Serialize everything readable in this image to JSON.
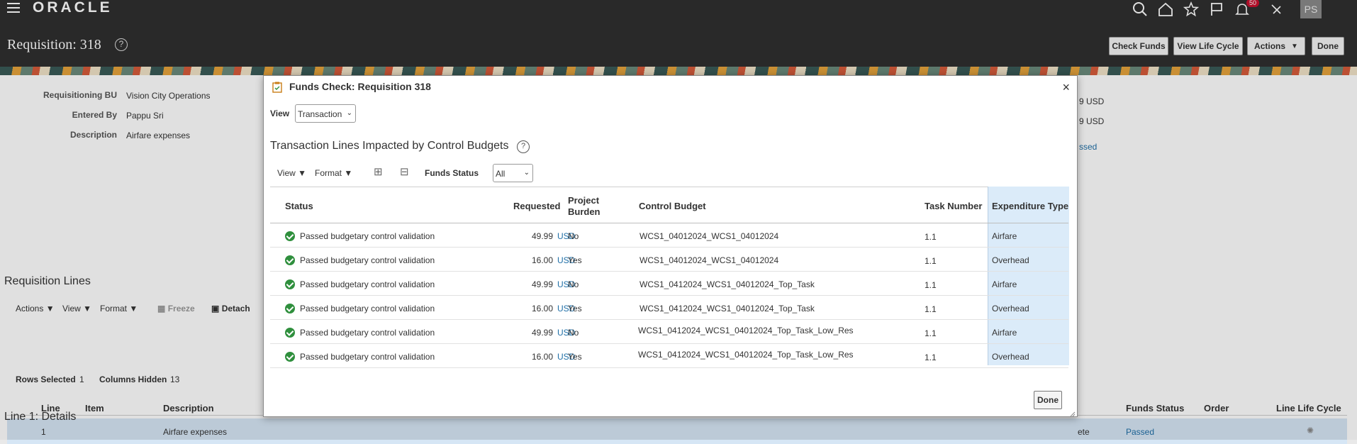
{
  "app": {
    "logo": "ORACLE",
    "notifications_count": "50",
    "user_initials": "PS"
  },
  "page": {
    "title": "Requisition: 318",
    "help": "?",
    "buttons": {
      "check_funds": "Check Funds",
      "view_life_cycle": "View Life Cycle",
      "actions": "Actions",
      "done": "Done"
    }
  },
  "summary": {
    "requisitioning_bu_label": "Requisitioning BU",
    "requisitioning_bu": "Vision City Operations",
    "entered_by_label": "Entered By",
    "entered_by": "Pappu Sri",
    "description_label": "Description",
    "description": "Airfare expenses",
    "right_val_1": "9 USD",
    "right_val_2": "9 USD",
    "right_val_3": "ssed"
  },
  "requisition_lines": {
    "title": "Requisition Lines",
    "toolbar": {
      "actions": "Actions",
      "view": "View",
      "format": "Format",
      "freeze": "Freeze",
      "detach": "Detach"
    },
    "columns": {
      "line": "Line",
      "item": "Item",
      "description": "Description",
      "funds_status": "Funds Status",
      "order": "Order",
      "line_life_cycle": "Line Life Cycle"
    },
    "row": {
      "line": "1",
      "description": "Airfare expenses",
      "status_partial": "ete",
      "funds_status": "Passed"
    },
    "rows_selected_label": "Rows Selected",
    "rows_selected": "1",
    "columns_hidden_label": "Columns Hidden",
    "columns_hidden": "13"
  },
  "line_details": {
    "title": "Line 1: Details"
  },
  "dialog": {
    "title": "Funds Check: Requisition 318",
    "close": "×",
    "view_label": "View",
    "view_value": "Transaction",
    "subtitle": "Transaction Lines Impacted by Control Budgets",
    "toolbar": {
      "view": "View",
      "format": "Format",
      "funds_status_label": "Funds Status",
      "funds_status_value": "All"
    },
    "columns": {
      "status": "Status",
      "requested": "Requested",
      "project_burden_1": "Project",
      "project_burden_2": "Burden",
      "control_budget": "Control Budget",
      "task_number": "Task Number",
      "expenditure_type": "Expenditure Type"
    },
    "rows": [
      {
        "status": "Passed budgetary control validation",
        "amount": "49.99",
        "currency": "USD",
        "burden": "No",
        "budget": "WCS1_04012024_WCS1_04012024",
        "task": "1.1",
        "exp_type": "Airfare"
      },
      {
        "status": "Passed budgetary control validation",
        "amount": "16.00",
        "currency": "USD",
        "burden": "Yes",
        "budget": "WCS1_04012024_WCS1_04012024",
        "task": "1.1",
        "exp_type": "Overhead"
      },
      {
        "status": "Passed budgetary control validation",
        "amount": "49.99",
        "currency": "USD",
        "burden": "No",
        "budget": "WCS1_0412024_WCS1_04012024_Top_Task",
        "task": "1.1",
        "exp_type": "Airfare"
      },
      {
        "status": "Passed budgetary control validation",
        "amount": "16.00",
        "currency": "USD",
        "burden": "Yes",
        "budget": "WCS1_0412024_WCS1_04012024_Top_Task",
        "task": "1.1",
        "exp_type": "Overhead"
      },
      {
        "status": "Passed budgetary control validation",
        "amount": "49.99",
        "currency": "USD",
        "burden": "No",
        "budget": "WCS1_0412024_WCS1_04012024_Top_Task_Low_Res",
        "task": "1.1",
        "exp_type": "Airfare"
      },
      {
        "status": "Passed budgetary control validation",
        "amount": "16.00",
        "currency": "USD",
        "burden": "Yes",
        "budget": "WCS1_0412024_WCS1_04012024_Top_Task_Low_Res",
        "task": "1.1",
        "exp_type": "Overhead"
      }
    ],
    "done": "Done"
  },
  "colors": {
    "header_bg": "#2f2f2f",
    "accent_blue": "#1f6fa7",
    "success_green": "#2f8f3d",
    "selection_blue": "#dbebf9",
    "badge_red": "#c8102e"
  },
  "icons": [
    "hamburger-icon",
    "search-icon",
    "home-icon",
    "star-icon",
    "flag-icon",
    "bell-icon",
    "signal-icon",
    "help-icon",
    "clipboard-icon",
    "close-icon",
    "check-circle-icon",
    "chevron-down-icon",
    "resize-icon"
  ]
}
